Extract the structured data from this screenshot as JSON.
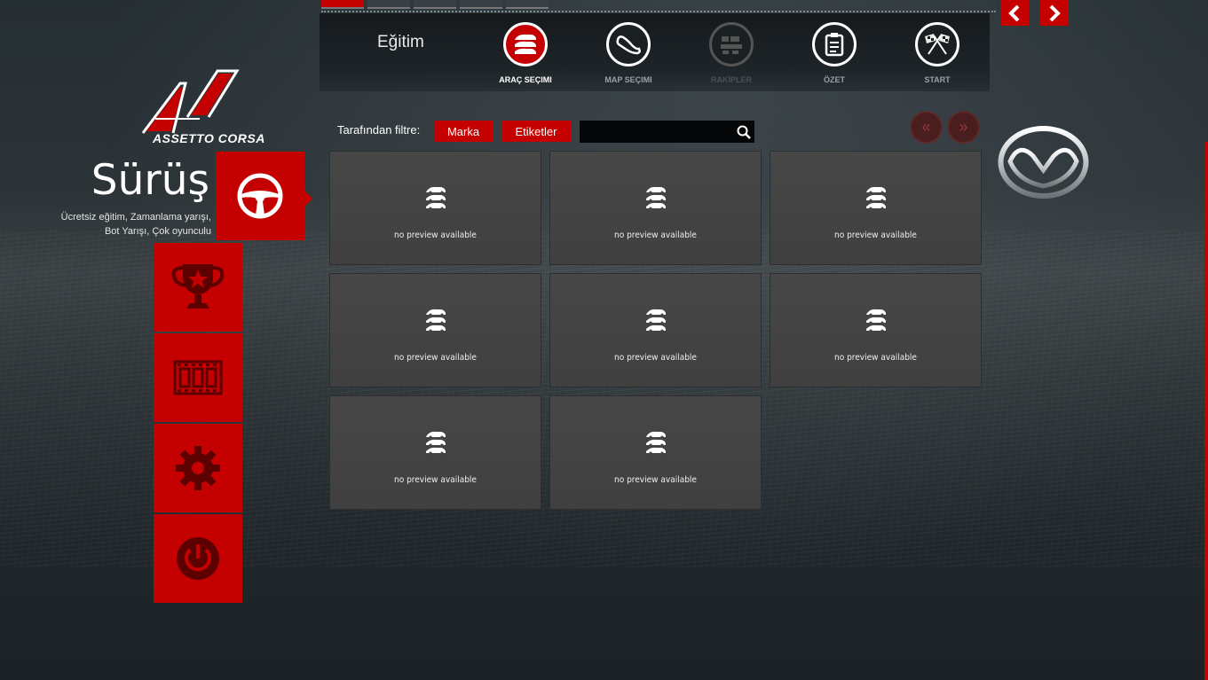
{
  "app": {
    "name": "Assetto Corsa",
    "logo_text": "ASSETTO CORSA"
  },
  "section": {
    "title": "Sürüş",
    "description_line1": "Ücretsiz eğitim, Zamanlama yarışı,",
    "description_line2": "Bot Yarışı, Çok oyunculu"
  },
  "mode": {
    "title": "Eğitim"
  },
  "steps": [
    {
      "label": "ARAÇ SEÇIMI",
      "state": "active",
      "icon": "car-select-icon"
    },
    {
      "label": "MAP SEÇIMI",
      "state": "normal",
      "icon": "track-icon"
    },
    {
      "label": "RAKIPLER",
      "state": "disabled",
      "icon": "opponents-icon"
    },
    {
      "label": "ÖZET",
      "state": "normal",
      "icon": "clipboard-icon"
    },
    {
      "label": "START",
      "state": "normal",
      "icon": "checkered-flags-icon"
    }
  ],
  "filter": {
    "label": "Tarafından filtre:",
    "brand_button": "Marka",
    "tags_button": "Etiketler",
    "search_placeholder": ""
  },
  "pager": {
    "prev": "«",
    "next": "»"
  },
  "nav": {
    "prev": "‹",
    "next": "›"
  },
  "cars": [
    {
      "preview": "no preview available"
    },
    {
      "preview": "no preview available"
    },
    {
      "preview": "no preview available"
    },
    {
      "preview": "no preview available"
    },
    {
      "preview": "no preview available"
    },
    {
      "preview": "no preview available"
    },
    {
      "preview": "no preview available"
    },
    {
      "preview": "no preview available"
    }
  ],
  "sidebar": [
    {
      "name": "drive",
      "icon": "steering-wheel-icon",
      "active": true
    },
    {
      "name": "career",
      "icon": "trophy-icon"
    },
    {
      "name": "replay",
      "icon": "film-strip-icon"
    },
    {
      "name": "settings",
      "icon": "gear-icon"
    },
    {
      "name": "quit",
      "icon": "power-icon"
    }
  ],
  "brand": {
    "icon": "mazda-logo"
  },
  "colors": {
    "accent": "#c40000",
    "card": "#444444",
    "background": "#1e262b"
  }
}
